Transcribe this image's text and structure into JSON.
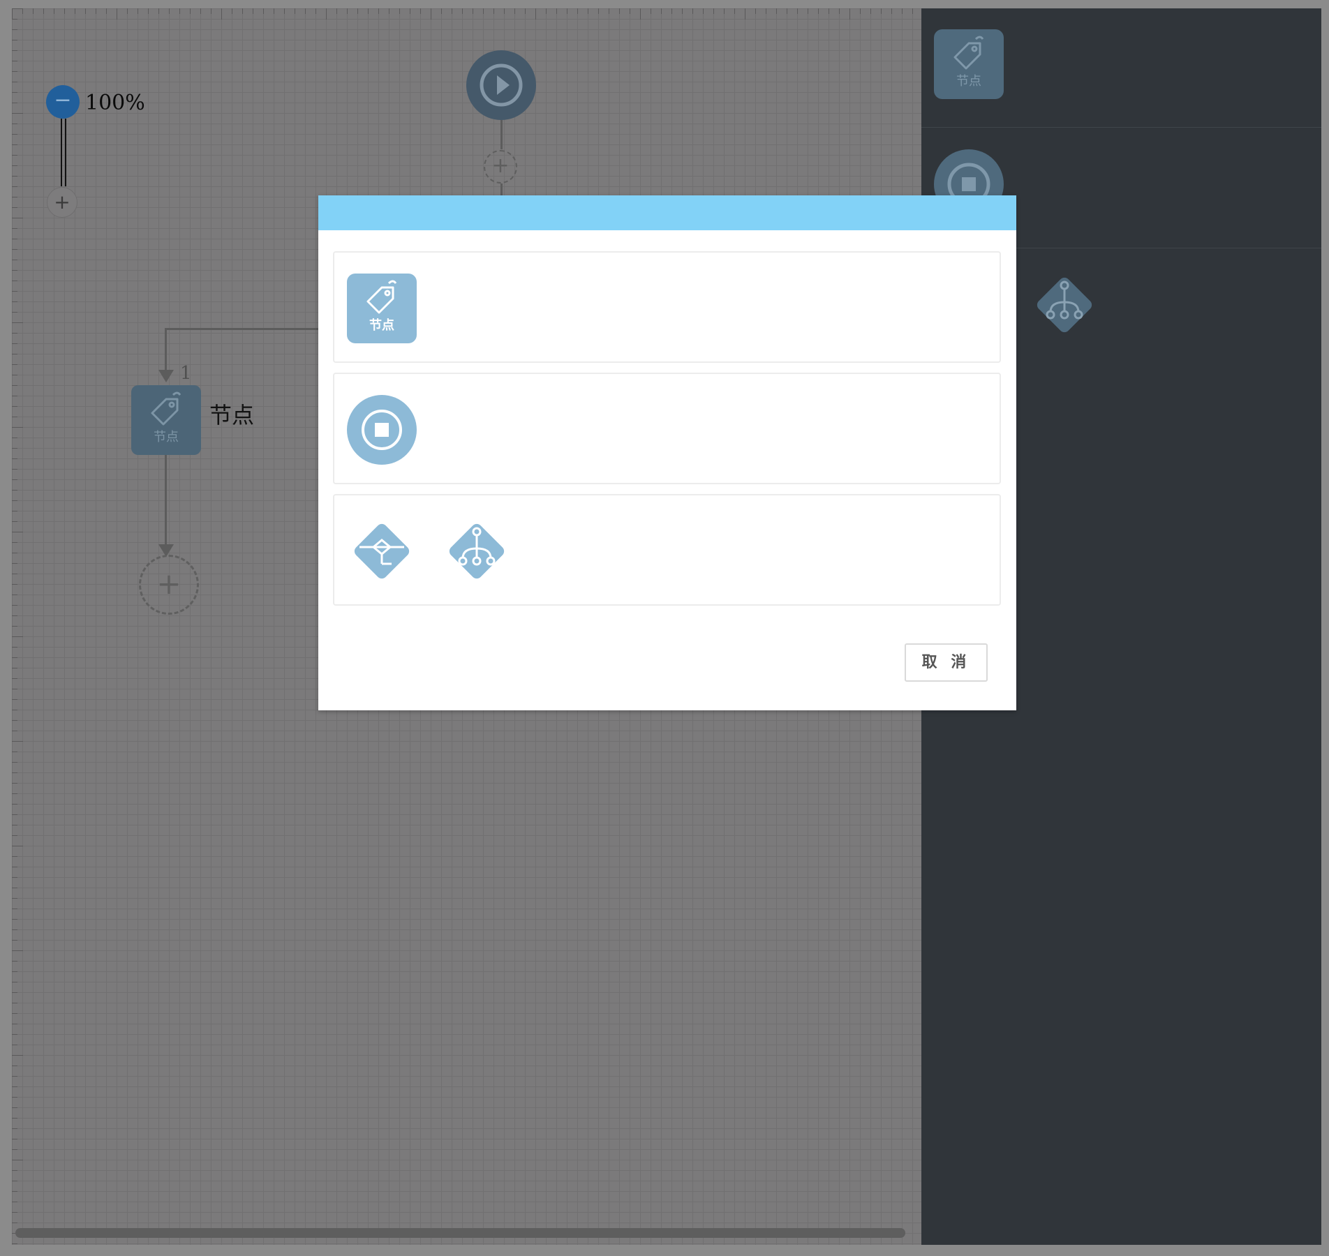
{
  "zoom": {
    "level_label": "100%",
    "minus_symbol": "−",
    "plus_symbol": "+"
  },
  "canvas": {
    "add_symbol": "+",
    "task_node": {
      "caption": "节点",
      "label": "节点",
      "edge_number": "1"
    }
  },
  "panel": {
    "task_caption": "节点"
  },
  "modal": {
    "task_option_caption": "节点",
    "cancel_label": "取 消"
  },
  "colors": {
    "modal_header": "#82d2f7",
    "option_fill": "#8dbad7",
    "panel_bg": "#30353a",
    "canvas_bg": "#7b7a7b",
    "zoom_accent": "#215f9b"
  },
  "icons": {
    "start": "play-circle-icon",
    "task": "tag-icon",
    "end": "stop-circle-icon",
    "exclusive_gateway": "branch-diamond-icon",
    "parallel_gateway": "fork-tree-diamond-icon"
  }
}
